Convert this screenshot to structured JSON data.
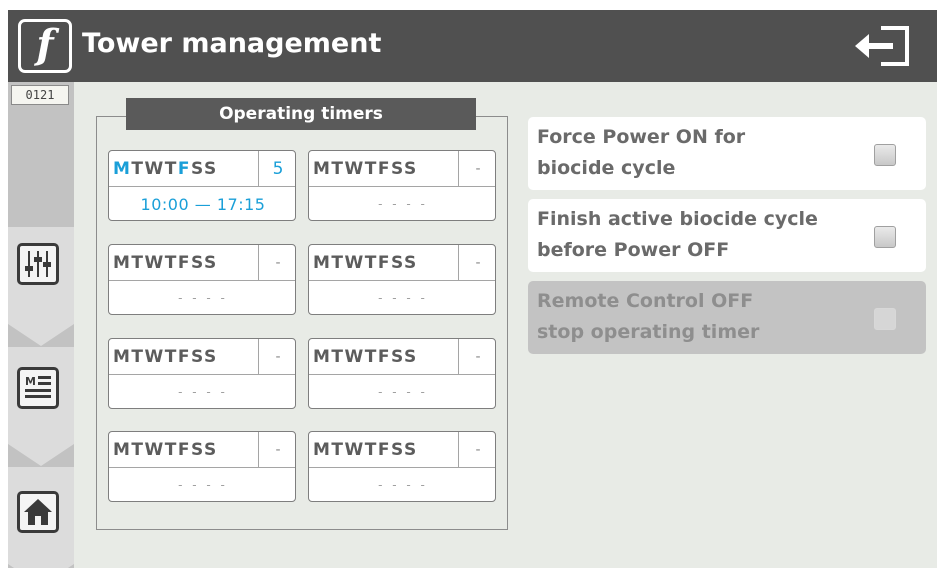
{
  "header": {
    "logo_text": "f",
    "title": "Tower management",
    "logout_icon": "logout-arrow-icon"
  },
  "sidebar": {
    "counter": "0121",
    "buttons": [
      {
        "name": "settings",
        "icon": "sliders-icon"
      },
      {
        "name": "list",
        "icon": "menu-list-icon"
      },
      {
        "name": "home",
        "icon": "home-icon"
      }
    ]
  },
  "timers": {
    "title": "Operating timers",
    "day_letters": [
      "M",
      "T",
      "W",
      "T",
      "F",
      "S",
      "S"
    ],
    "items": [
      {
        "active_days": [
          true,
          false,
          false,
          false,
          true,
          false,
          false
        ],
        "count": "5",
        "time": "10:00 — 17:15",
        "enabled": true
      },
      {
        "active_days": [
          false,
          false,
          false,
          false,
          false,
          false,
          false
        ],
        "count": "-",
        "time": "- - - -",
        "enabled": false
      },
      {
        "active_days": [
          false,
          false,
          false,
          false,
          false,
          false,
          false
        ],
        "count": "-",
        "time": "- - - -",
        "enabled": false
      },
      {
        "active_days": [
          false,
          false,
          false,
          false,
          false,
          false,
          false
        ],
        "count": "-",
        "time": "- - - -",
        "enabled": false
      },
      {
        "active_days": [
          false,
          false,
          false,
          false,
          false,
          false,
          false
        ],
        "count": "-",
        "time": "- - - -",
        "enabled": false
      },
      {
        "active_days": [
          false,
          false,
          false,
          false,
          false,
          false,
          false
        ],
        "count": "-",
        "time": "- - - -",
        "enabled": false
      },
      {
        "active_days": [
          false,
          false,
          false,
          false,
          false,
          false,
          false
        ],
        "count": "-",
        "time": "- - - -",
        "enabled": false
      },
      {
        "active_days": [
          false,
          false,
          false,
          false,
          false,
          false,
          false
        ],
        "count": "-",
        "time": "- - - -",
        "enabled": false
      }
    ]
  },
  "options": [
    {
      "line1": "Force Power ON for",
      "line2": "biocide cycle",
      "checked": false,
      "disabled": false
    },
    {
      "line1": "Finish active biocide cycle",
      "line2": "before Power OFF",
      "checked": false,
      "disabled": false
    },
    {
      "line1": "Remote Control OFF",
      "line2": "stop operating timer",
      "checked": false,
      "disabled": true
    }
  ],
  "colors": {
    "header": "#505050",
    "accent_blue": "#1a9fd8",
    "background": "#e8ebe6",
    "sidebar": "#c2c2c2"
  }
}
